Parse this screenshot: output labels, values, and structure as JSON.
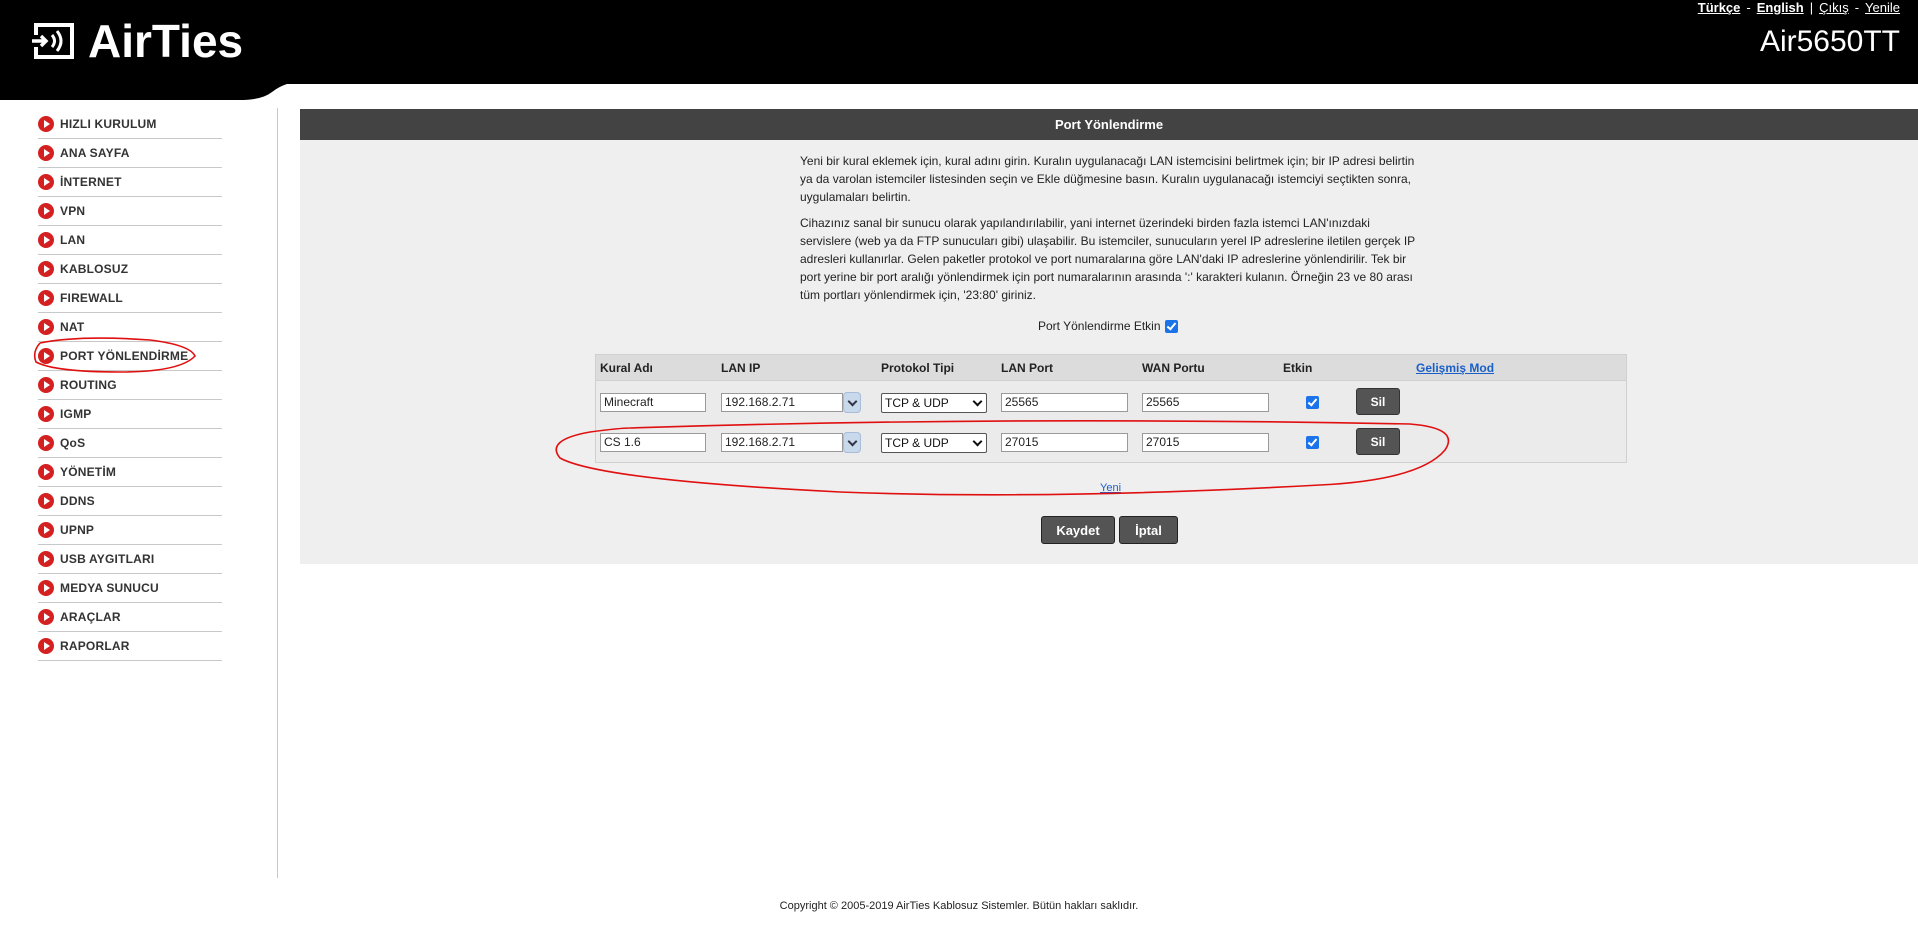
{
  "header": {
    "brand": "AirTies",
    "model": "Air5650TT",
    "links": {
      "turkce": "Türkçe",
      "english": "English",
      "cikis": "Çıkış",
      "yenile": "Yenile",
      "sep_dash": "-",
      "sep_bar": "|"
    }
  },
  "sidebar": {
    "items": [
      {
        "label": "HIZLI KURULUM"
      },
      {
        "label": "ANA SAYFA"
      },
      {
        "label": "İNTERNET"
      },
      {
        "label": "VPN"
      },
      {
        "label": "LAN"
      },
      {
        "label": "KABLOSUZ"
      },
      {
        "label": "FIREWALL"
      },
      {
        "label": "NAT"
      },
      {
        "label": "PORT YÖNLENDİRME"
      },
      {
        "label": "ROUTING"
      },
      {
        "label": "IGMP"
      },
      {
        "label": "QoS"
      },
      {
        "label": "YÖNETİM"
      },
      {
        "label": "DDNS"
      },
      {
        "label": "UPNP"
      },
      {
        "label": "USB AYGITLARI"
      },
      {
        "label": "MEDYA SUNUCU"
      },
      {
        "label": "ARAÇLAR"
      },
      {
        "label": "RAPORLAR"
      }
    ]
  },
  "main": {
    "title": "Port Yönlendirme",
    "desc1": "Yeni bir kural eklemek için, kural adını girin. Kuralın uygulanacağı LAN istemcisini belirtmek için; bir IP adresi belirtin ya da varolan istemciler listesinden seçin ve Ekle düğmesine basın. Kuralın uygulanacağı istemciyi seçtikten sonra, uygulamaları belirtin.",
    "desc2": "Cihazınız sanal bir sunucu olarak yapılandırılabilir, yani internet üzerindeki birden fazla istemci LAN'ınızdaki servislere (web ya da FTP sunucuları gibi) ulaşabilir. Bu istemciler, sunucuların yerel IP adreslerine iletilen gerçek IP adresleri kullanırlar. Gelen paketler protokol ve port numaralarına göre LAN'daki IP adreslerine yönlendirilir. Tek bir port yerine bir port aralığı yönlendirmek için port numaralarının arasında ':' karakteri kulanın. Örneğin 23 ve 80 arası tüm portları yönlendirmek için, '23:80' giriniz.",
    "enable_label": "Port Yönlendirme Etkin",
    "columns": {
      "name": "Kural Adı",
      "lan_ip": "LAN IP",
      "protocol": "Protokol Tipi",
      "lan_port": "LAN Port",
      "wan_port": "WAN Portu",
      "enabled": "Etkin",
      "advanced": "Gelişmiş Mod"
    },
    "rules": [
      {
        "name": "Minecraft",
        "lan_ip": "192.168.2.71",
        "protocol": "TCP & UDP",
        "lan_port": "25565",
        "wan_port": "25565",
        "delete_label": "Sil"
      },
      {
        "name": "CS 1.6",
        "lan_ip": "192.168.2.71",
        "protocol": "TCP & UDP",
        "lan_port": "27015",
        "wan_port": "27015",
        "delete_label": "Sil"
      }
    ],
    "new_link": "Yeni",
    "save_label": "Kaydet",
    "cancel_label": "İptal"
  },
  "footer": "Copyright © 2005-2019 AirTies Kablosuz Sistemler. Bütün hakları saklıdır.",
  "colors": {
    "header_bg": "#000000",
    "panel_title_bg": "#434343",
    "bullet": "#d42020",
    "link": "#1a5fc8",
    "annotation": "#e01010"
  }
}
